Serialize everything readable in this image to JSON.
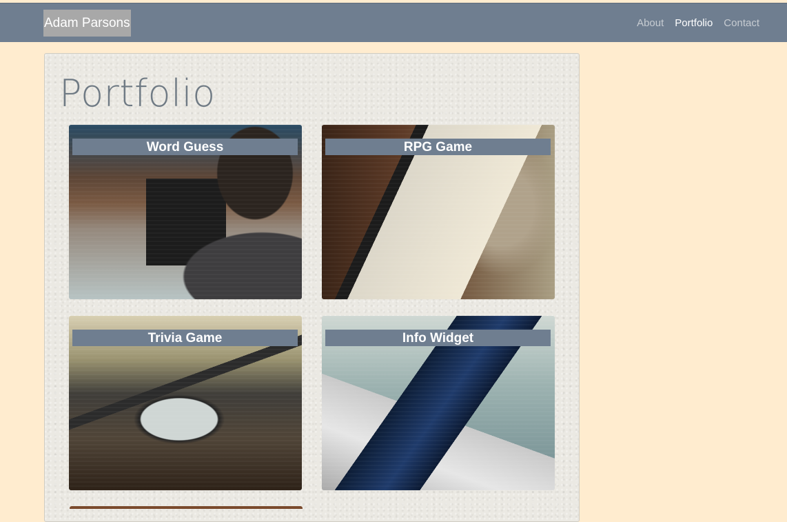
{
  "nav": {
    "brand": "Adam Parsons",
    "links": [
      {
        "label": "About",
        "active": false
      },
      {
        "label": "Portfolio",
        "active": true
      },
      {
        "label": "Contact",
        "active": false
      }
    ]
  },
  "main": {
    "title": "Portfolio",
    "projects": [
      {
        "label": "Word Guess",
        "image": "laptop-code-photo"
      },
      {
        "label": "RPG Game",
        "image": "tablet-welcome-photo"
      },
      {
        "label": "Trivia Game",
        "image": "phone-on-laptop-photo"
      },
      {
        "label": "Info Widget",
        "image": "laptop-terminal-photo"
      }
    ]
  },
  "colors": {
    "page_bg": "#ffeccf",
    "navbar": "#6f7e90",
    "label_bg": "#6f7e90",
    "panel": "#ebe9e3"
  }
}
